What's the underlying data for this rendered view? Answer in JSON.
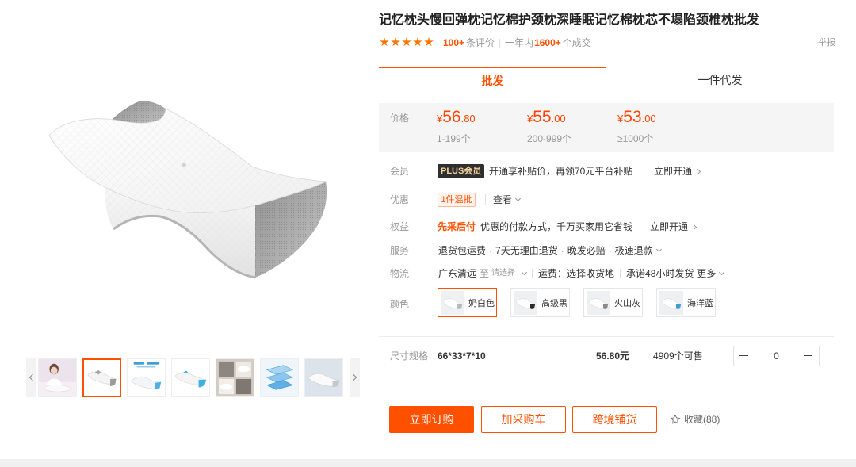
{
  "colors": {
    "accent": "#ff5000",
    "price": "#ff4400",
    "star": "#ff7300",
    "plus_badge_bg": "#2f2f2f",
    "plus_badge_text": "#f3d29b"
  },
  "product": {
    "title": "记忆枕头慢回弹枕记忆棉护颈枕深睡眠记忆棉枕芯不塌陷颈椎枕批发",
    "rating": 5,
    "review_count": "100+",
    "review_label": "条评价",
    "sales_period": "一年内",
    "sales_count": "1600+",
    "sales_label": "个成交",
    "report": "举报"
  },
  "gallery": {
    "main_image_icon": "memory-foam-pillow-image",
    "selected_thumbnail": 1,
    "thumbnails": [
      "model-with-pillow-thumbnail",
      "white-pillow-thumbnail",
      "pillow-feature-banner-thumbnail",
      "pillow-blue-side-thumbnail",
      "pillow-lifestyle-photo-thumbnail",
      "pillow-layer-diagram-thumbnail",
      "pillow-on-blue-background-thumbnail"
    ]
  },
  "tabs": [
    {
      "label": "批发",
      "active": true
    },
    {
      "label": "一件代发",
      "active": false
    }
  ],
  "price": {
    "label": "价格",
    "currency": "¥",
    "tiers": [
      {
        "integer": "56",
        "decimal": ".80",
        "range": "1-199个"
      },
      {
        "integer": "55",
        "decimal": ".00",
        "range": "200-999个"
      },
      {
        "integer": "53",
        "decimal": ".00",
        "range": "≥1000个"
      }
    ]
  },
  "member": {
    "label": "会员",
    "badge": "PLUS会员",
    "text": "开通享补贴价，再领70元平台补贴",
    "action": "立即开通"
  },
  "discount": {
    "label": "优惠",
    "badge": "1件混批",
    "action": "查看"
  },
  "benefit": {
    "label": "权益",
    "highlight": "先采后付",
    "text": "优惠的付款方式，千万买家用它省钱",
    "action": "立即开通"
  },
  "service": {
    "label": "服务",
    "items": [
      "退货包运费",
      "7天无理由退货",
      "晚发必赔",
      "极速退款"
    ]
  },
  "logistics": {
    "label": "物流",
    "from": "广东清远",
    "to_label": "至",
    "to_placeholder": "请选择",
    "fee": "运费：选择收货地",
    "promise": "承诺48小时发货",
    "more": "更多"
  },
  "color": {
    "label": "颜色",
    "options": [
      {
        "name": "奶白色",
        "swatch": "#b9b9b9",
        "selected": true
      },
      {
        "name": "高级黑",
        "swatch": "#2b2b2b",
        "selected": false
      },
      {
        "name": "火山灰",
        "swatch": "#8a8a8a",
        "selected": false
      },
      {
        "name": "海洋蓝",
        "swatch": "#3f9fd8",
        "selected": false
      }
    ]
  },
  "size": {
    "label": "尺寸规格",
    "spec": "66*33*7*10",
    "price": "56.80元",
    "stock": "4909个可售",
    "quantity": "0"
  },
  "actions": {
    "buy": "立即订购",
    "cart": "加采购车",
    "cross_border": "跨境铺货",
    "favorite": "收藏(88)"
  }
}
